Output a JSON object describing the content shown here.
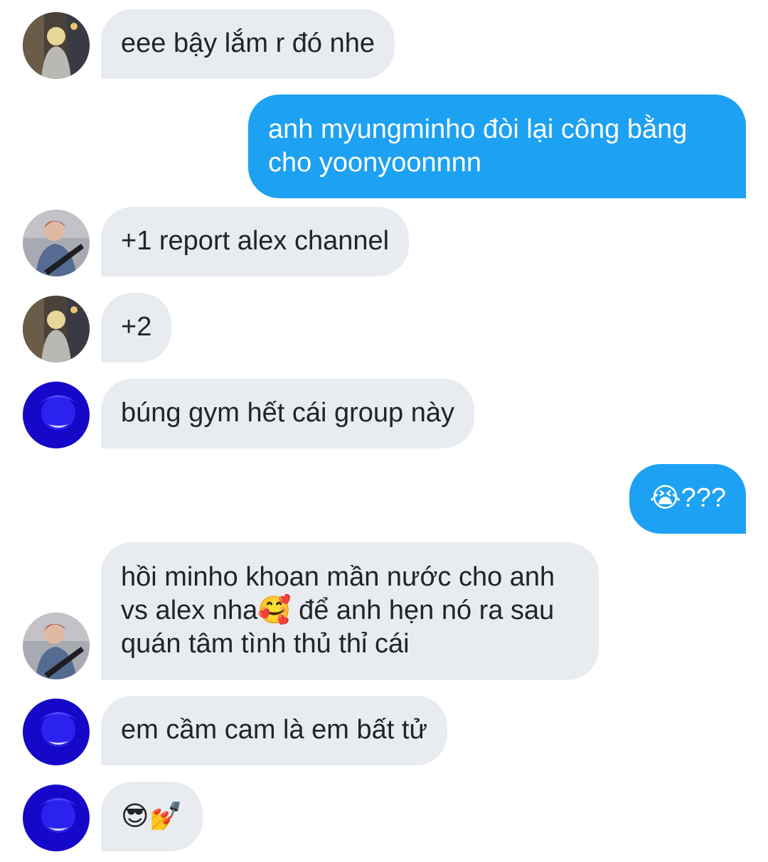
{
  "conversation": {
    "messages": [
      {
        "side": "incoming",
        "sender_avatar": "avatar-blonde-street",
        "text": "eee bậy lắm r đó nhe"
      },
      {
        "side": "outgoing",
        "text": "anh myungminho đòi lại công bằng\ncho yoonyoonnnn"
      },
      {
        "side": "incoming",
        "sender_avatar": "avatar-redhair-guitar",
        "text": "+1 report alex channel"
      },
      {
        "side": "incoming",
        "sender_avatar": "avatar-blonde-street",
        "text": "+2"
      },
      {
        "side": "incoming",
        "sender_avatar": "avatar-blue-portrait",
        "text": "búng gym hết cái group này"
      },
      {
        "side": "outgoing",
        "text": "😭???"
      },
      {
        "side": "incoming",
        "sender_avatar": "avatar-redhair-guitar",
        "text": "hồi minho khoan mần nước cho anh\nvs alex nha🥰 để anh hẹn nó ra sau\nquán tâm tình thủ thỉ cái"
      },
      {
        "side": "incoming",
        "sender_avatar": "avatar-blue-portrait",
        "text": "em cầm cam là em bất tử"
      },
      {
        "side": "incoming",
        "sender_avatar": "avatar-blue-portrait",
        "text": "😎💅"
      }
    ]
  },
  "colors": {
    "incoming_bubble": "#e8ecf0",
    "outgoing_bubble": "#1da1f2",
    "incoming_text": "#222427",
    "outgoing_text": "#ffffff"
  }
}
